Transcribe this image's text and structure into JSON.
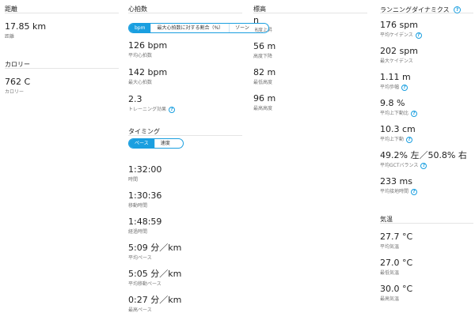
{
  "distance": {
    "title": "距離",
    "value": "17.85 km",
    "label": "距離"
  },
  "calories": {
    "title": "カロリー",
    "value": "762 C",
    "label": "カロリー"
  },
  "heart_rate": {
    "title": "心拍数",
    "toggle": [
      "bpm",
      "最大心拍数に対する割合（%）",
      "ゾーン"
    ],
    "active_toggle": "bpm",
    "stats": [
      {
        "value": "126 bpm",
        "label": "平均心拍数"
      },
      {
        "value": "142 bpm",
        "label": "最大心拍数"
      },
      {
        "value": "2.3",
        "label": "トレーニング効果"
      }
    ]
  },
  "timing": {
    "title": "タイミング",
    "toggle": [
      "ペース",
      "速度"
    ],
    "active_toggle": "ペース",
    "stats": [
      {
        "value": "1:32:00",
        "label": "時間"
      },
      {
        "value": "1:30:36",
        "label": "移動時間"
      },
      {
        "value": "1:48:59",
        "label": "経過時間"
      },
      {
        "value": "5:09 分／km",
        "label": "平均ペース"
      },
      {
        "value": "5:05 分／km",
        "label": "平均移動ペース"
      },
      {
        "value": "0:27 分／km",
        "label": "最高ペース"
      }
    ]
  },
  "elevation": {
    "title": "標高",
    "stats": [
      {
        "value": "n",
        "label": "高度上昇"
      },
      {
        "value": "56 m",
        "label": "高度下降"
      },
      {
        "value": "82 m",
        "label": "最低高度"
      },
      {
        "value": "96 m",
        "label": "最高高度"
      }
    ]
  },
  "running_dynamics": {
    "title": "ランニングダイナミクス",
    "stats": [
      {
        "value": "176 spm",
        "label": "平均ケイデンス"
      },
      {
        "value": "202 spm",
        "label": "最大ケイデンス"
      },
      {
        "value": "1.11 m",
        "label": "平均歩幅"
      },
      {
        "value": "9.8 %",
        "label": "平均上下動比"
      },
      {
        "value": "10.3 cm",
        "label": "平均上下動"
      },
      {
        "value": "49.2% 左／50.8% 右",
        "label": "平均GCTバランス"
      },
      {
        "value": "233 ms",
        "label": "平均接地時間"
      }
    ]
  },
  "temperature": {
    "title": "気温",
    "stats": [
      {
        "value": "27.7 °C",
        "label": "平均気温"
      },
      {
        "value": "27.0 °C",
        "label": "最低気温"
      },
      {
        "value": "30.0 °C",
        "label": "最高気温"
      }
    ]
  },
  "icons": {
    "help": "?"
  },
  "colors": {
    "accent": "#1a9fe0"
  }
}
